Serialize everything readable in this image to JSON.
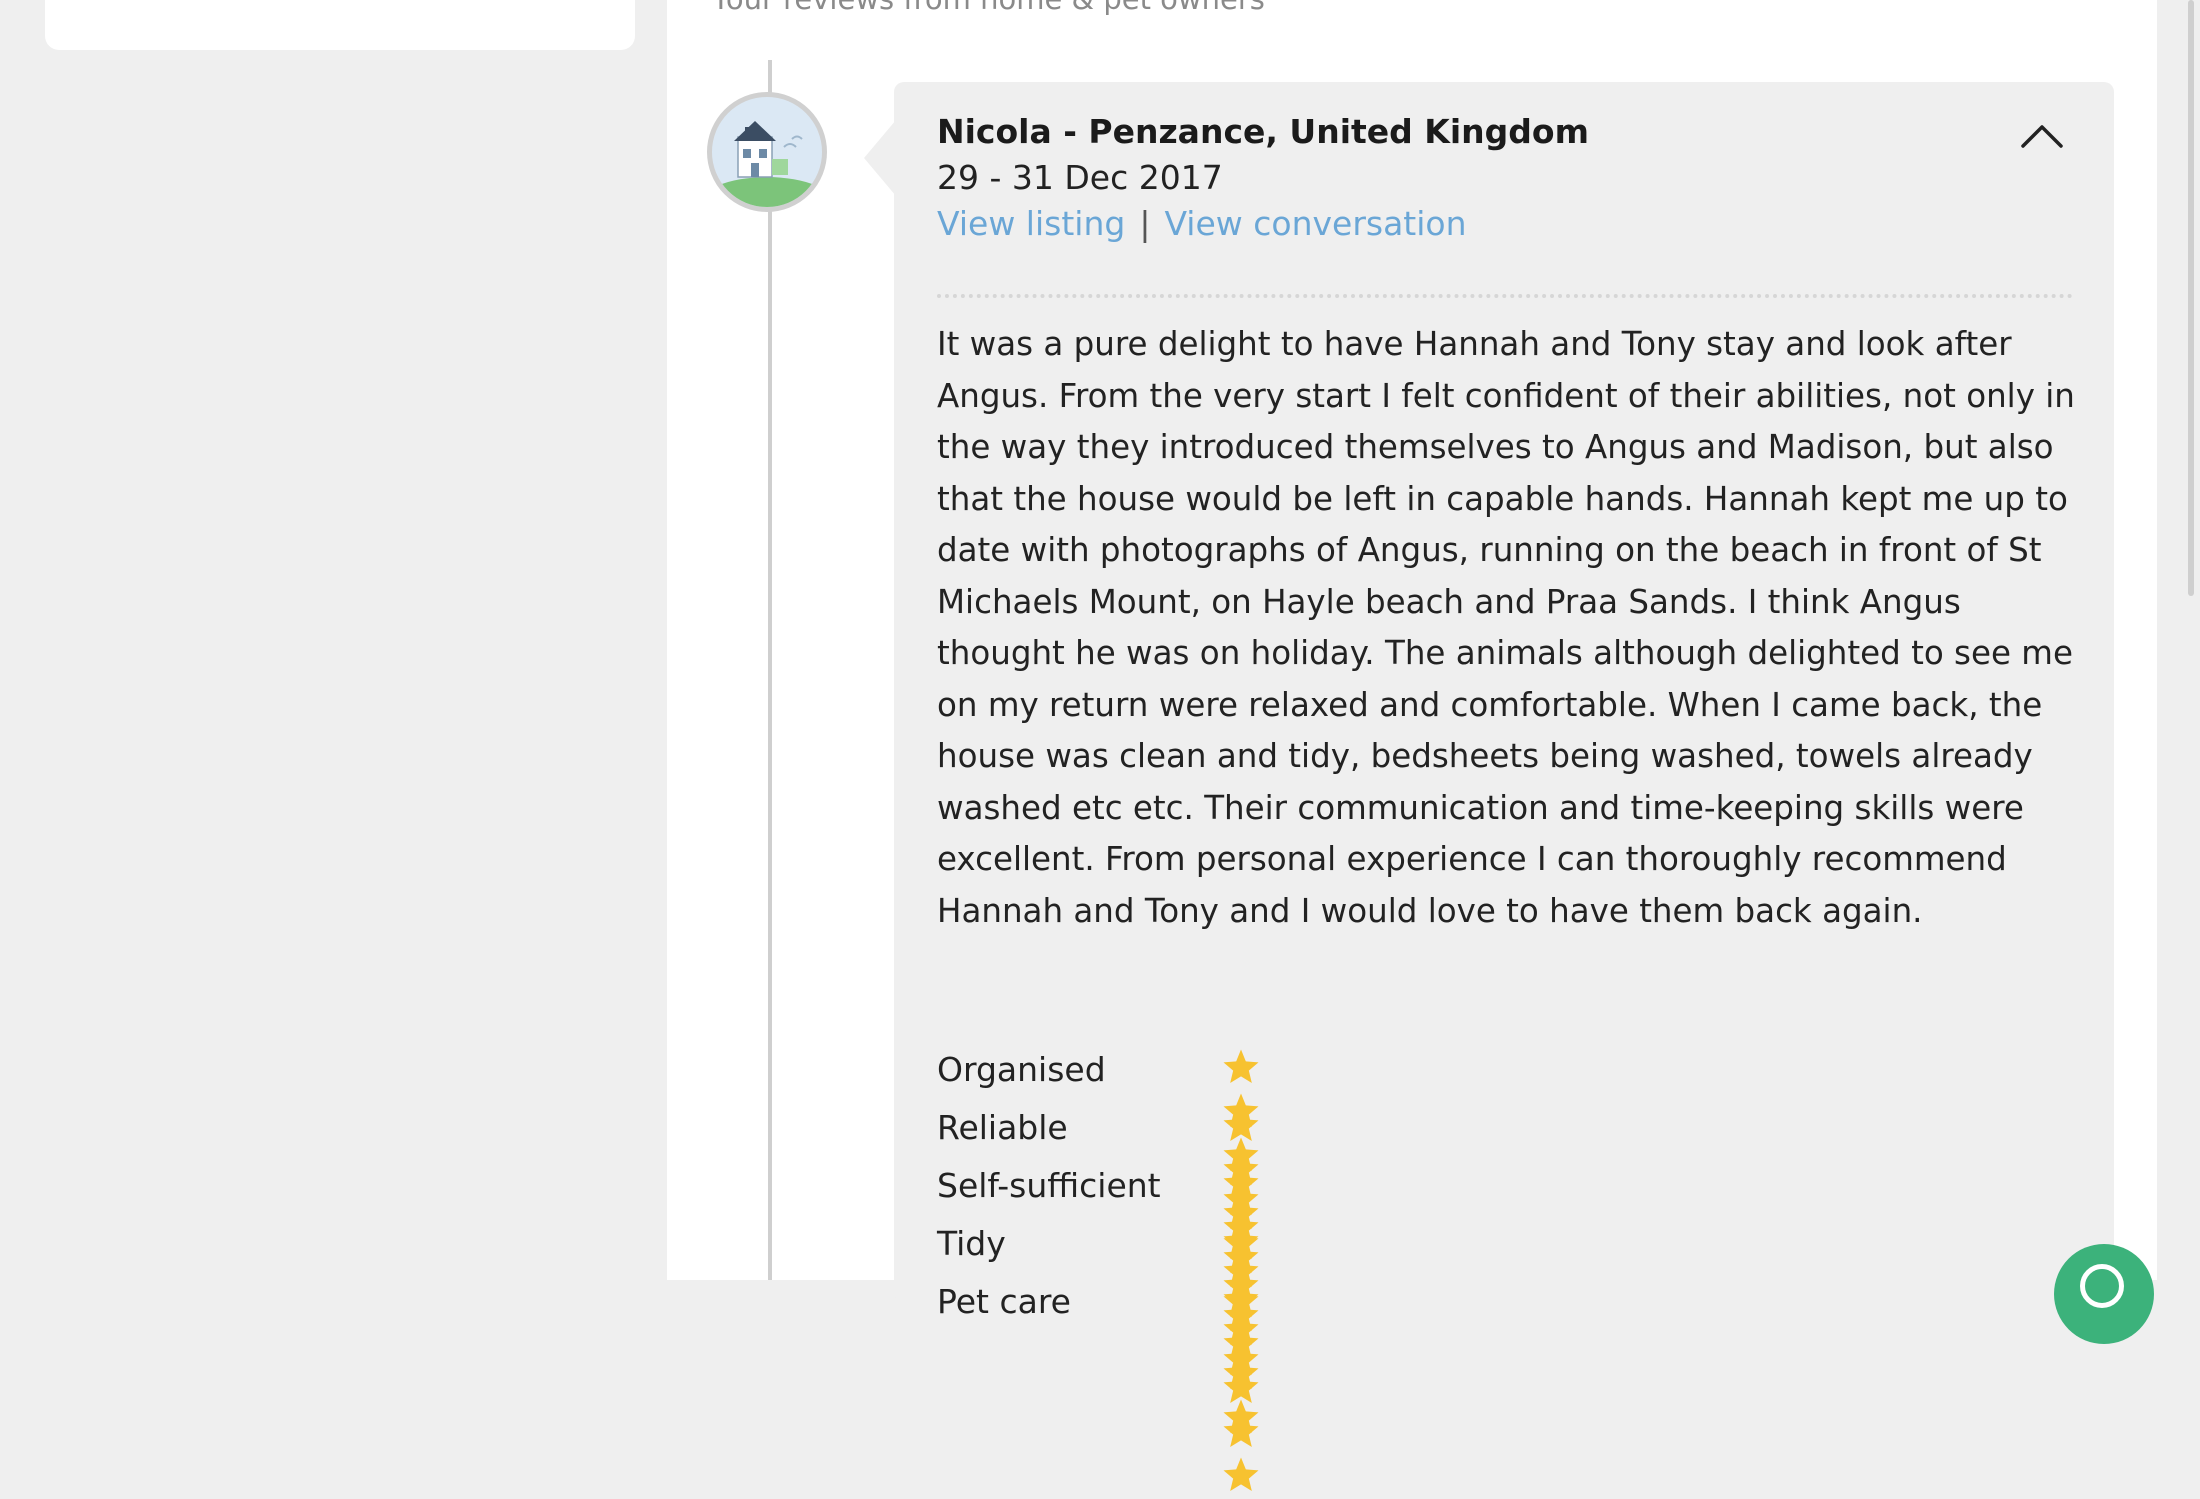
{
  "page": {
    "subtitle": "Your reviews from home & pet owners"
  },
  "review": {
    "reviewer": "Nicola - Penzance, United Kingdom",
    "dates": "29 - 31 Dec 2017",
    "view_listing_label": "View listing",
    "separator": "|",
    "view_conversation_label": "View conversation",
    "text": "It was a pure delight to have Hannah and Tony stay and look after Angus. From the very start I felt confident of their abilities, not only in the way they introduced themselves to Angus and Madison, but also that the house would be left in capable hands. Hannah kept me up to date with photographs of Angus, running on the beach in front of St Michaels Mount, on Hayle beach and Praa Sands. I think Angus thought he was on holiday. The animals although delighted to see me on my return were relaxed and comfortable. When I came back, the house was clean and tidy, bedsheets being washed, towels already washed etc etc. Their communication and time-keeping skills were excellent. From personal experience I can thoroughly recommend Hannah and Tony and I would love to have them back again.",
    "ratings": [
      {
        "label": "Organised",
        "stars": 5,
        "max": 5
      },
      {
        "label": "Reliable",
        "stars": 5,
        "max": 5
      },
      {
        "label": "Self-sufficient",
        "stars": 5,
        "max": 5
      },
      {
        "label": "Tidy",
        "stars": 5,
        "max": 5
      },
      {
        "label": "Pet care",
        "stars": 5,
        "max": 5
      }
    ]
  },
  "icons": {
    "avatar": "house-avatar-icon",
    "collapse": "chevron-up-icon",
    "star": "star-icon",
    "fab": "chat-icon"
  },
  "colors": {
    "link": "#6aa6d6",
    "star": "#f7c230",
    "fab": "#3cb27b",
    "card_bg": "#efefef"
  }
}
